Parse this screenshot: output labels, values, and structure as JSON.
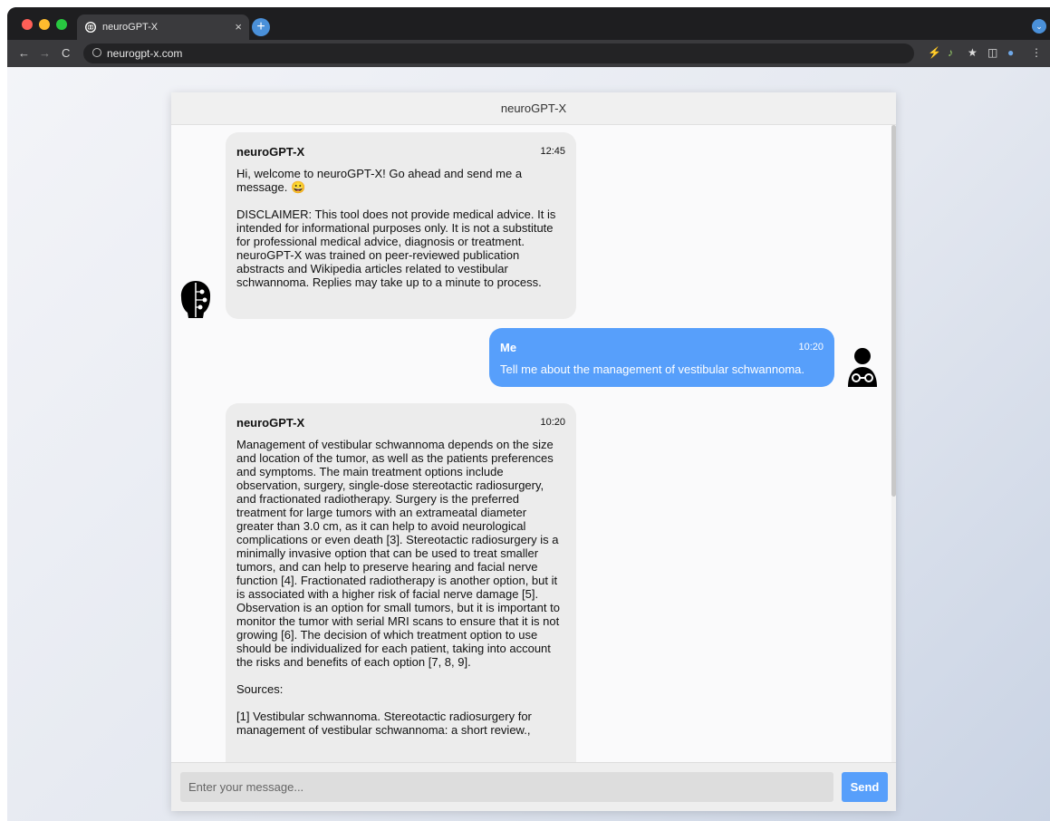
{
  "browser": {
    "tab_title": "neuroGPT-X",
    "tab_close": "×",
    "new_tab": "+",
    "url": "neurogpt-x.com",
    "nav": {
      "back": "←",
      "forward": "→",
      "reload": "C"
    },
    "extensions": [
      "⚡",
      "♪",
      "★",
      "◫",
      "●",
      "⋮"
    ]
  },
  "chat": {
    "header_title": "neuroGPT-X",
    "messages": [
      {
        "sender": "neuroGPT-X",
        "time": "12:45",
        "text": "Hi, welcome to neuroGPT-X! Go ahead and send me a message. 😀\n\nDISCLAIMER: This tool does not provide medical advice. It is intended for informational purposes only. It is not a substitute for professional medical advice, diagnosis or treatment. neuroGPT-X was trained on peer-reviewed publication abstracts and Wikipedia articles related to vestibular schwannoma. Replies may take up to a minute to process."
      },
      {
        "sender": "Me",
        "time": "10:20",
        "text": "Tell me about the management of vestibular schwannoma."
      },
      {
        "sender": "neuroGPT-X",
        "time": "10:20",
        "text": "Management of vestibular schwannoma depends on the size and location of the tumor, as well as the patients preferences and symptoms. The main treatment options include observation, surgery, single-dose stereotactic radiosurgery, and fractionated radiotherapy. Surgery is the preferred treatment for large tumors with an extrameatal diameter greater than 3.0 cm, as it can help to avoid neurological complications or even death [3]. Stereotactic radiosurgery is a minimally invasive option that can be used to treat smaller tumors, and can help to preserve hearing and facial nerve function [4]. Fractionated radiotherapy is another option, but it is associated with a higher risk of facial nerve damage [5]. Observation is an option for small tumors, but it is important to monitor the tumor with serial MRI scans to ensure that it is not growing [6]. The decision of which treatment option to use should be individualized for each patient, taking into account the risks and benefits of each option [7, 8, 9].\n\nSources:\n\n[1] Vestibular schwannoma. Stereotactic radiosurgery for management of vestibular schwannoma: a short review.,"
      }
    ],
    "input_placeholder": "Enter your message...",
    "send_label": "Send"
  },
  "colors": {
    "accent": "#579ffb",
    "bot_bubble": "#ececec"
  }
}
